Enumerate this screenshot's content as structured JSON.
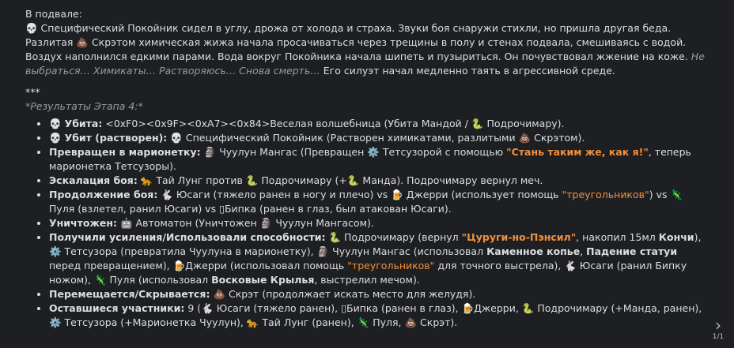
{
  "header": "В подвале:",
  "para": {
    "e1": "💀",
    "t1": " Специфический Покойник сидел в углу, дрожа от холода и страха. Звуки боя снаружи стихли, но пришла другая беда. Разлитая ",
    "e2": "💩",
    "t2": " Скрэтом химическая жижа начала просачиваться через трещины в полу и стенах подвала, смешиваясь с водой. Воздух наполнился едкими парами. Вода вокруг Покойника начала шипеть и пузыриться. Он почувствовал жжение на коже. ",
    "italic": "Не выбраться… Химикаты… Растворяюсь… Снова смерть…",
    "t3": " Его силуэт начал медленно таять в агрессивной среде."
  },
  "separator": "***",
  "results_heading": "*Результаты Этапа 4:*",
  "items": {
    "killed": {
      "label": "Убита:",
      "icon": "💀",
      "text": " <0xF0><0x9F><0xA7><0x84>Веселая волшебница (Убита Мандой / ",
      "icon2": "🐍",
      "text2": " Подрочимару)."
    },
    "dissolved": {
      "label": "Убит (растворен):",
      "icon": "💀",
      "icon2": "💀",
      "text": " Специфический Покойник (Растворен химикатами, разлитыми ",
      "icon3": "💩",
      "text2": " Скрэтом)."
    },
    "puppet": {
      "label": "Превращен в марионетку:",
      "icon": "🗿",
      "text": " Чуулун Мангас (Превращен ",
      "icon2": "⚙️",
      "text2": " Тетсузорой с помощью ",
      "quote": "\"Стань таким же, как я!\"",
      "text3": ", теперь марионетка Тетсузоры)."
    },
    "escalation": {
      "label": "Эскалация боя:",
      "icon": "🐆",
      "text": " Тай Лунг против ",
      "icon2": "🐍",
      "text2": " Подрочимару (+",
      "icon3": "🐍",
      "text3": " Манда). Подрочимару вернул меч."
    },
    "continued": {
      "label": "Продолжение боя:",
      "icon": "🐇",
      "text": " Юсаги (тяжело ранен в ногу и плечо) vs ",
      "icon2": "🍺",
      "text2": " Джерри (использует помощь ",
      "quote": "\"треугольников\"",
      "text3": ") vs ",
      "icon3": "🦎",
      "text4": " Пуля (взлетел, ранил Юсаги) vs ",
      "icon4": "▯",
      "text5": "Бипка (ранен в глаз, был атакован Юсаги)."
    },
    "destroyed": {
      "label": "Уничтожен:",
      "icon": "🤖",
      "text": " Автоматон (Уничтожен ",
      "icon2": "🗿",
      "text2": " Чуулун Мангасом)."
    },
    "upgrades": {
      "label": "Получили усиления/Использовали способности:",
      "icon": "🐍",
      "text": " Подрочимару (вернул ",
      "quote": "\"Цуруги-но-Пэнсил\"",
      "text2": ", накопил 15мл ",
      "bold1": "Кончи",
      "text3": "), ",
      "icon2": "⚙️",
      "text4": " Тетсузора (превратила Чуулуна в марионетку), ",
      "icon3": "🗿",
      "text5": " Чуулун Мангас (использовал ",
      "bold2": "Каменное копье",
      "text6": ", ",
      "bold3": "Падение статуи",
      "text7": " перед превращением), ",
      "icon4": "🍺",
      "text8": "Джерри (использовал помощь ",
      "quote2": "\"треугольников\"",
      "text9": " для точного выстрела), ",
      "icon5": "🐇",
      "text10": " Юсаги (ранил Бипку ножом), ",
      "icon6": "🦎",
      "text11": " Пуля (использовал ",
      "bold4": "Восковые Крылья",
      "text12": ", выстрелил мечом)."
    },
    "moving": {
      "label": "Перемещается/Скрывается:",
      "icon": "💩",
      "text": " Скрэт (продолжает искать место для желудя)."
    },
    "remaining": {
      "label": "Оставшиеся участники:",
      "text": " 9 (",
      "icon": "🐇",
      "text2": " Юсаги (тяжело ранен), ",
      "icon2": "▯",
      "text3": "Бипка (ранен в глаз), ",
      "icon3": "🍺",
      "text4": "Джерри, ",
      "icon4": "🐍",
      "text5": " Подрочимару (+Манда, ранен), ",
      "icon5": "⚙️",
      "text6": " Тетсузора (+Марионетка Чуулун), ",
      "icon6": "🐆",
      "text7": " Тай Лунг (ранен), ",
      "icon7": "🦎",
      "text8": " Пуля, ",
      "icon8": "💩",
      "text9": " Скрэт)."
    }
  },
  "nav": {
    "arrow": "›",
    "page": "1/1"
  }
}
